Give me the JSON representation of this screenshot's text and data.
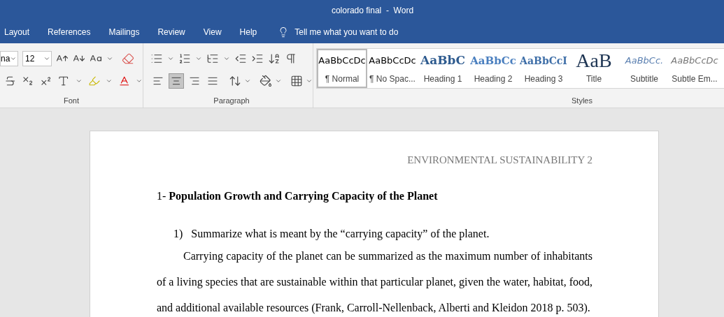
{
  "window": {
    "title": "colorado final  -  Word"
  },
  "tabs": [
    {
      "label": "Layout",
      "selected": false
    },
    {
      "label": "References",
      "selected": false
    },
    {
      "label": "Mailings",
      "selected": false
    },
    {
      "label": "Review",
      "selected": false
    },
    {
      "label": "View",
      "selected": false
    },
    {
      "label": "Help",
      "selected": false
    }
  ],
  "tell_me": {
    "placeholder": "Tell me what you want to do"
  },
  "font_group": {
    "label": "Font",
    "font_name": "na",
    "font_size": "12"
  },
  "paragraph_group": {
    "label": "Paragraph",
    "alignment": [
      {
        "kind": "left",
        "selected": false
      },
      {
        "kind": "center",
        "selected": true
      },
      {
        "kind": "right",
        "selected": false
      },
      {
        "kind": "justify",
        "selected": false
      }
    ]
  },
  "styles_group": {
    "label": "Styles",
    "styles": [
      {
        "kind": "normal",
        "sample": "AaBbCcDc",
        "name": "¶ Normal",
        "selected": true
      },
      {
        "kind": "nospacing",
        "sample": "AaBbCcDc",
        "name": "¶ No Spac...",
        "selected": false
      },
      {
        "kind": "heading1",
        "sample": "AaBbC",
        "name": "Heading 1",
        "selected": false
      },
      {
        "kind": "heading2",
        "sample": "AaBbCc",
        "name": "Heading 2",
        "selected": false
      },
      {
        "kind": "heading3",
        "sample": "AaBbCcI",
        "name": "Heading 3",
        "selected": false
      },
      {
        "kind": "title",
        "sample": "AaB",
        "name": "Title",
        "selected": false
      },
      {
        "kind": "subtitle",
        "sample": "AaBbCc.",
        "name": "Subtitle",
        "selected": false
      },
      {
        "kind": "subtle",
        "sample": "AaBbCcDc",
        "name": "Subtle Em...",
        "selected": false
      }
    ]
  },
  "document": {
    "header": "ENVIRONMENTAL SUSTAINABILITY 2",
    "heading": "1- **Population Growth and Carrying Capacity of the Planet**",
    "list_item": {
      "number": "1)",
      "text": "Summarize what is meant by the “carrying capacity” of the planet."
    },
    "paragraph": "Carrying capacity of the planet can be summarized as the maximum number of inhabitants of a living species that are sustainable within that particular planet, given the water, habitat, food, and additional available resources (Frank, Carroll-Nellenback, Alberti and Kleidon 2018 p. 503)."
  }
}
